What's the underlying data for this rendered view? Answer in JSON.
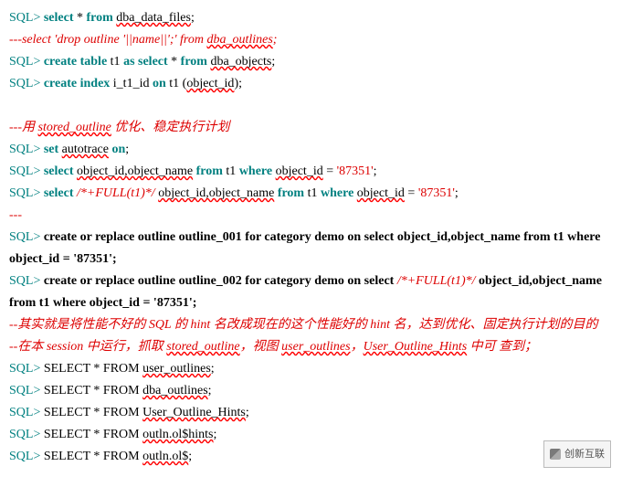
{
  "lines": [
    {
      "segments": [
        {
          "cls": "prompt",
          "t": "SQL>"
        },
        {
          "cls": "",
          "t": " "
        },
        {
          "cls": "kw",
          "t": "select"
        },
        {
          "cls": "",
          "t": " * "
        },
        {
          "cls": "kw",
          "t": "from"
        },
        {
          "cls": "",
          "t": " "
        },
        {
          "cls": "id-u",
          "t": "dba_data_files"
        },
        {
          "cls": "",
          "t": ";"
        }
      ]
    },
    {
      "segments": [
        {
          "cls": "comment",
          "t": "---select 'drop outline '||name||';' from "
        },
        {
          "cls": "comment id-u",
          "t": "dba_outlines"
        },
        {
          "cls": "comment",
          "t": ";"
        }
      ]
    },
    {
      "segments": [
        {
          "cls": "prompt",
          "t": "SQL>"
        },
        {
          "cls": "",
          "t": " "
        },
        {
          "cls": "kw",
          "t": "create table"
        },
        {
          "cls": "",
          "t": " t1 "
        },
        {
          "cls": "kw",
          "t": "as select"
        },
        {
          "cls": "",
          "t": " * "
        },
        {
          "cls": "kw",
          "t": "from"
        },
        {
          "cls": "",
          "t": " "
        },
        {
          "cls": "id-u",
          "t": "dba_objects"
        },
        {
          "cls": "",
          "t": ";"
        }
      ]
    },
    {
      "segments": [
        {
          "cls": "prompt",
          "t": "SQL>"
        },
        {
          "cls": "",
          "t": " "
        },
        {
          "cls": "kw",
          "t": "create index"
        },
        {
          "cls": "",
          "t": " i_t1_id "
        },
        {
          "cls": "kw",
          "t": "on"
        },
        {
          "cls": "",
          "t": " t1 ("
        },
        {
          "cls": "id-u",
          "t": "object_id"
        },
        {
          "cls": "",
          "t": ");"
        }
      ]
    },
    {
      "segments": [
        {
          "cls": "",
          "t": " "
        }
      ]
    },
    {
      "segments": [
        {
          "cls": "comment",
          "t": "---用 "
        },
        {
          "cls": "comment id-u",
          "t": "stored_outline"
        },
        {
          "cls": "comment",
          "t": " 优化、稳定执行计划"
        }
      ]
    },
    {
      "segments": [
        {
          "cls": "prompt",
          "t": "SQL>"
        },
        {
          "cls": "",
          "t": " "
        },
        {
          "cls": "kw",
          "t": "set"
        },
        {
          "cls": "",
          "t": " "
        },
        {
          "cls": "id-u",
          "t": "autotrace"
        },
        {
          "cls": "",
          "t": " "
        },
        {
          "cls": "kw",
          "t": "on"
        },
        {
          "cls": "",
          "t": ";"
        }
      ]
    },
    {
      "segments": [
        {
          "cls": "prompt",
          "t": "SQL>"
        },
        {
          "cls": "",
          "t": " "
        },
        {
          "cls": "kw",
          "t": "select"
        },
        {
          "cls": "",
          "t": " "
        },
        {
          "cls": "id-u",
          "t": "object_id,object_name"
        },
        {
          "cls": "",
          "t": " "
        },
        {
          "cls": "kw",
          "t": "from"
        },
        {
          "cls": "",
          "t": " t1 "
        },
        {
          "cls": "kw",
          "t": "where"
        },
        {
          "cls": "",
          "t": " "
        },
        {
          "cls": "id-u",
          "t": "object_id"
        },
        {
          "cls": "",
          "t": " = "
        },
        {
          "cls": "lit",
          "t": "'87351'"
        },
        {
          "cls": "",
          "t": ";"
        }
      ]
    },
    {
      "segments": [
        {
          "cls": "prompt",
          "t": "SQL>"
        },
        {
          "cls": "",
          "t": " "
        },
        {
          "cls": "kw",
          "t": "select"
        },
        {
          "cls": "",
          "t": " "
        },
        {
          "cls": "hint",
          "t": "/*+FULL(t1)*/"
        },
        {
          "cls": "",
          "t": " "
        },
        {
          "cls": "id-u",
          "t": "object_id,object_name"
        },
        {
          "cls": "",
          "t": " "
        },
        {
          "cls": "kw",
          "t": "from"
        },
        {
          "cls": "",
          "t": " t1 "
        },
        {
          "cls": "kw",
          "t": "where"
        },
        {
          "cls": "",
          "t": " "
        },
        {
          "cls": "id-u",
          "t": "object_id"
        },
        {
          "cls": "",
          "t": " = "
        },
        {
          "cls": "lit",
          "t": "'87351'"
        },
        {
          "cls": "",
          "t": ";"
        }
      ]
    },
    {
      "segments": [
        {
          "cls": "comment",
          "t": "---"
        }
      ]
    },
    {
      "segments": [
        {
          "cls": "prompt",
          "t": "SQL>"
        },
        {
          "cls": "",
          "t": " "
        },
        {
          "cls": "kw-b",
          "t": "create or replace outline outline_001 for category demo on select object_id,object_name from t1 where object_id = '87351';"
        }
      ]
    },
    {
      "segments": [
        {
          "cls": "prompt",
          "t": "SQL>"
        },
        {
          "cls": "",
          "t": " "
        },
        {
          "cls": "kw-b",
          "t": "create or replace outline outline_002 for category demo on select "
        },
        {
          "cls": "hint",
          "t": "/*+FULL(t1)*/"
        },
        {
          "cls": "kw-b",
          "t": " object_id,object_name from t1 where object_id = '87351';"
        }
      ]
    },
    {
      "segments": [
        {
          "cls": "comment",
          "t": "--其实就是将性能不好的 SQL 的 hint 名改成现在的这个性能好的 hint 名，达到优化、固定执行计划的目的"
        }
      ]
    },
    {
      "segments": [
        {
          "cls": "comment",
          "t": "--在本 session 中运行，抓取 "
        },
        {
          "cls": "comment id-u",
          "t": "stored_outline"
        },
        {
          "cls": "comment",
          "t": "，视图 "
        },
        {
          "cls": "comment id-u",
          "t": "user_outlines"
        },
        {
          "cls": "comment",
          "t": "，"
        },
        {
          "cls": "comment id-u",
          "t": "User_Outline_Hints"
        },
        {
          "cls": "comment",
          "t": " 中可 查到；"
        }
      ]
    },
    {
      "segments": [
        {
          "cls": "prompt",
          "t": "SQL>"
        },
        {
          "cls": "",
          "t": " SELECT * FROM "
        },
        {
          "cls": "id-u",
          "t": "user_outlines"
        },
        {
          "cls": "",
          "t": ";"
        }
      ]
    },
    {
      "segments": [
        {
          "cls": "prompt",
          "t": "SQL>"
        },
        {
          "cls": "",
          "t": " SELECT * FROM "
        },
        {
          "cls": "id-u",
          "t": "dba_outlines"
        },
        {
          "cls": "",
          "t": ";"
        }
      ]
    },
    {
      "segments": [
        {
          "cls": "prompt",
          "t": "SQL>"
        },
        {
          "cls": "",
          "t": " SELECT * FROM "
        },
        {
          "cls": "id-u",
          "t": "User_Outline_Hints"
        },
        {
          "cls": "",
          "t": ";"
        }
      ]
    },
    {
      "segments": [
        {
          "cls": "prompt",
          "t": "SQL>"
        },
        {
          "cls": "",
          "t": " SELECT * FROM "
        },
        {
          "cls": "id-u",
          "t": "outln.ol$hints"
        },
        {
          "cls": "",
          "t": ";"
        }
      ]
    },
    {
      "segments": [
        {
          "cls": "prompt",
          "t": "SQL>"
        },
        {
          "cls": "",
          "t": " SELECT * FROM "
        },
        {
          "cls": "id-u",
          "t": "outln.ol$"
        },
        {
          "cls": "",
          "t": ";"
        }
      ]
    }
  ],
  "watermark": "创新互联"
}
